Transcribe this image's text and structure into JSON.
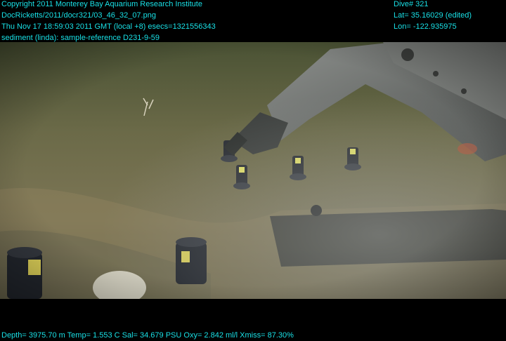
{
  "header_left": {
    "line1": "Copyright 2011 Monterey Bay Aquarium Research Institute",
    "line2": "DocRicketts/2011/docr321/03_46_32_07.png",
    "line3": "Thu Nov 17 18:59:03 2011 GMT (local +8)  esecs=1321556343",
    "line4": "sediment (linda): sample-reference D231-9-59"
  },
  "header_right": {
    "dive": "Dive# 321",
    "lat": "Lat= 35.16029 (edited)",
    "lon": "Lon= -122.935975"
  },
  "footer": {
    "telemetry": "Depth= 3975.70 m  Temp= 1.553 C  Sal= 34.679 PSU  Oxy= 2.842 ml/l  Xmiss= 87.30%"
  },
  "colors": {
    "overlay_text": "#19e0e6",
    "background": "#000000"
  }
}
